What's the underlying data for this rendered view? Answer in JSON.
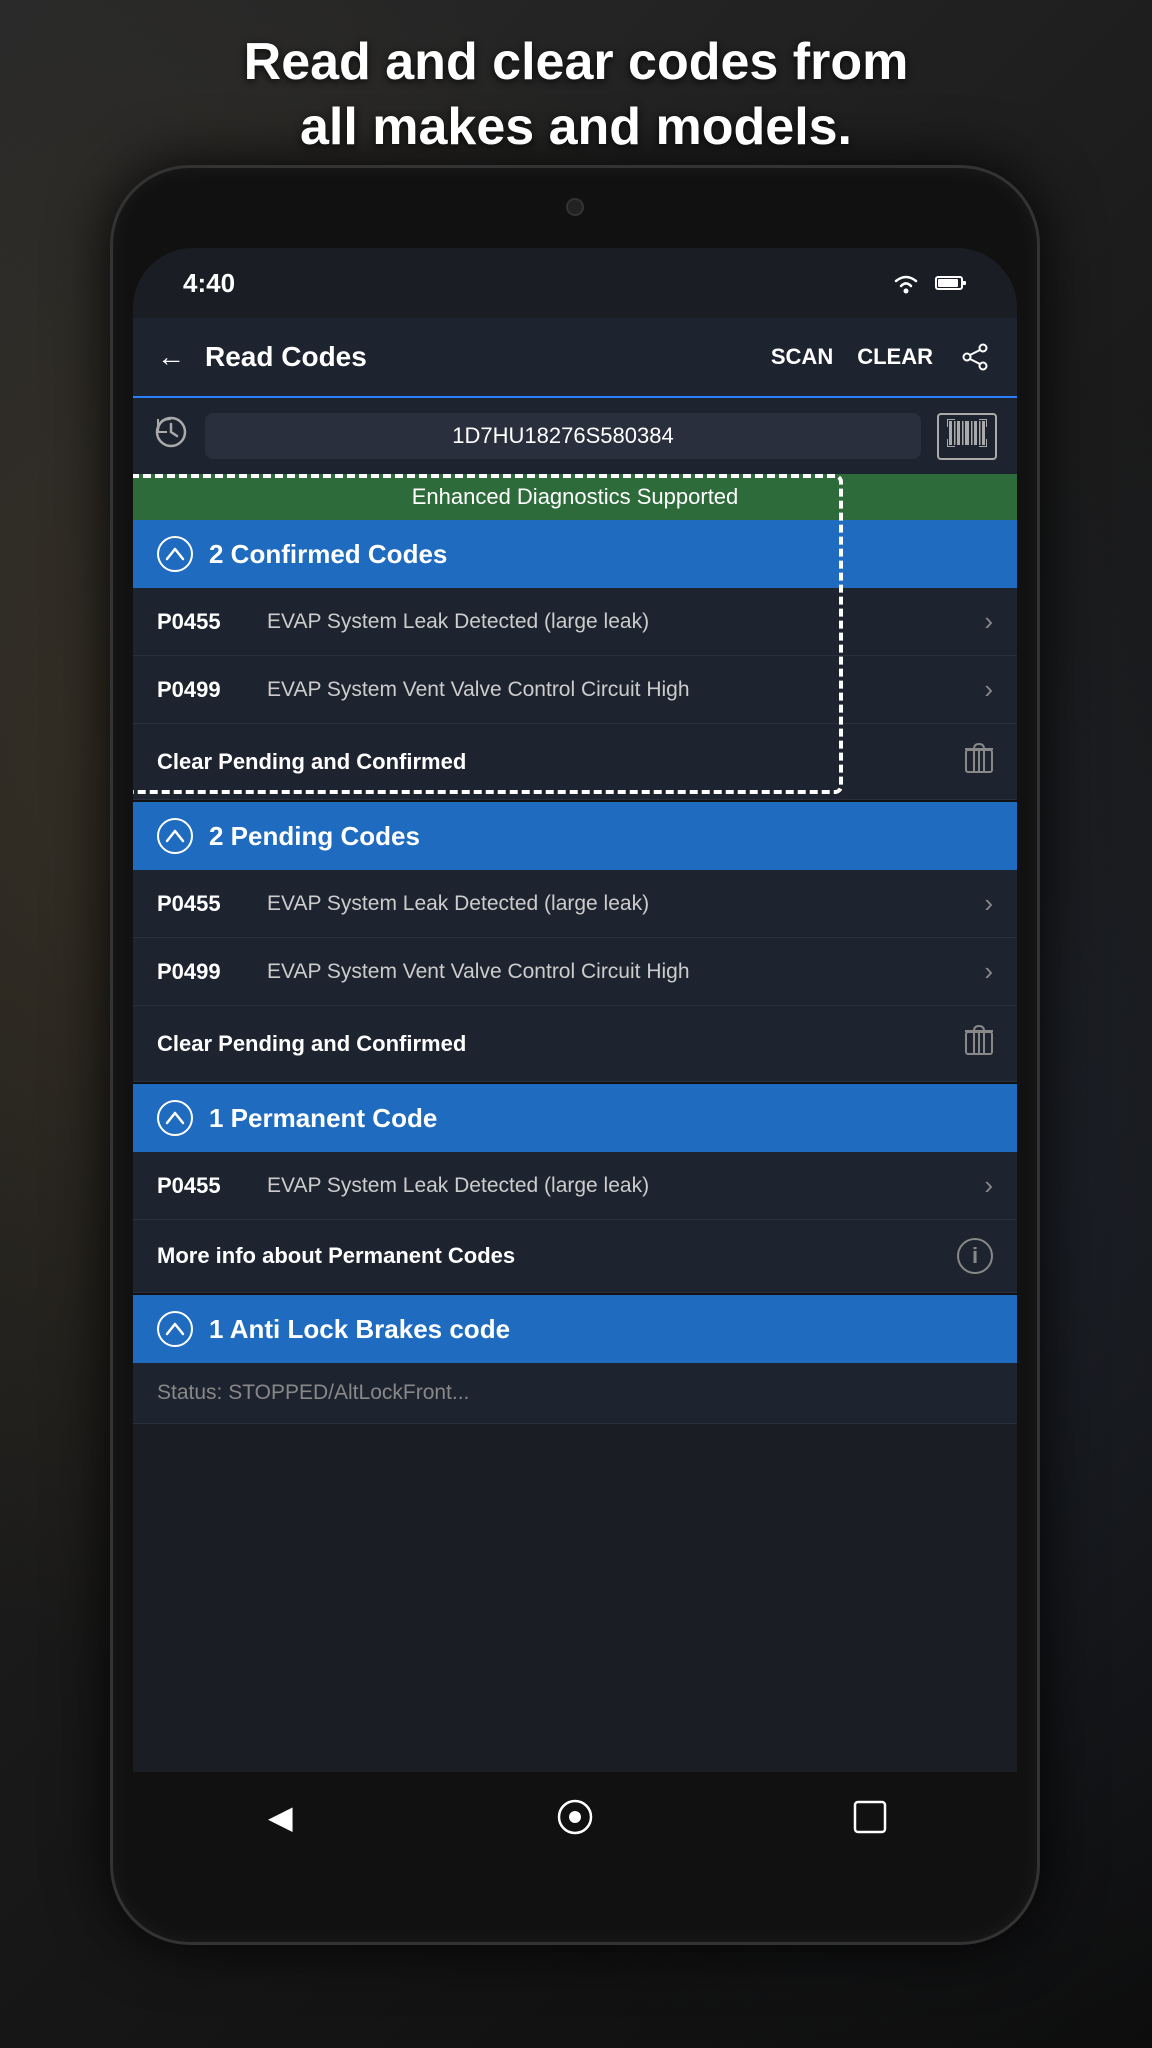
{
  "page": {
    "header_text": "Read and clear codes from\nall makes and models.",
    "status": {
      "time": "4:40",
      "wifi": "WiFi",
      "battery": "Battery"
    },
    "app_bar": {
      "back_arrow": "←",
      "title": "Read Codes",
      "scan": "SCAN",
      "clear": "CLEAR",
      "share": "share"
    },
    "vin": {
      "value": "1D7HU18276S580384",
      "placeholder": "VIN"
    },
    "enhanced_banner": "Enhanced Diagnostics Supported",
    "sections": [
      {
        "id": "confirmed",
        "title": "2 Confirmed Codes",
        "codes": [
          {
            "id": "P0455",
            "desc": "EVAP System Leak Detected (large leak)"
          },
          {
            "id": "P0499",
            "desc": "EVAP System Vent Valve Control Circuit High"
          }
        ],
        "clear_label": "Clear Pending and Confirmed"
      },
      {
        "id": "pending",
        "title": "2 Pending Codes",
        "codes": [
          {
            "id": "P0455",
            "desc": "EVAP System Leak Detected (large leak)"
          },
          {
            "id": "P0499",
            "desc": "EVAP System Vent Valve Control Circuit High"
          }
        ],
        "clear_label": "Clear Pending and Confirmed"
      },
      {
        "id": "permanent",
        "title": "1 Permanent Code",
        "codes": [
          {
            "id": "P0455",
            "desc": "EVAP System Leak Detected (large leak)"
          }
        ],
        "info_label": "More info about Permanent Codes"
      },
      {
        "id": "abs",
        "title": "1 Anti Lock Brakes code",
        "truncated": "Status: STOPPED/AltLockFront..."
      }
    ],
    "bottom_nav": {
      "back": "◀",
      "home": "⬤",
      "recent": "■"
    }
  }
}
